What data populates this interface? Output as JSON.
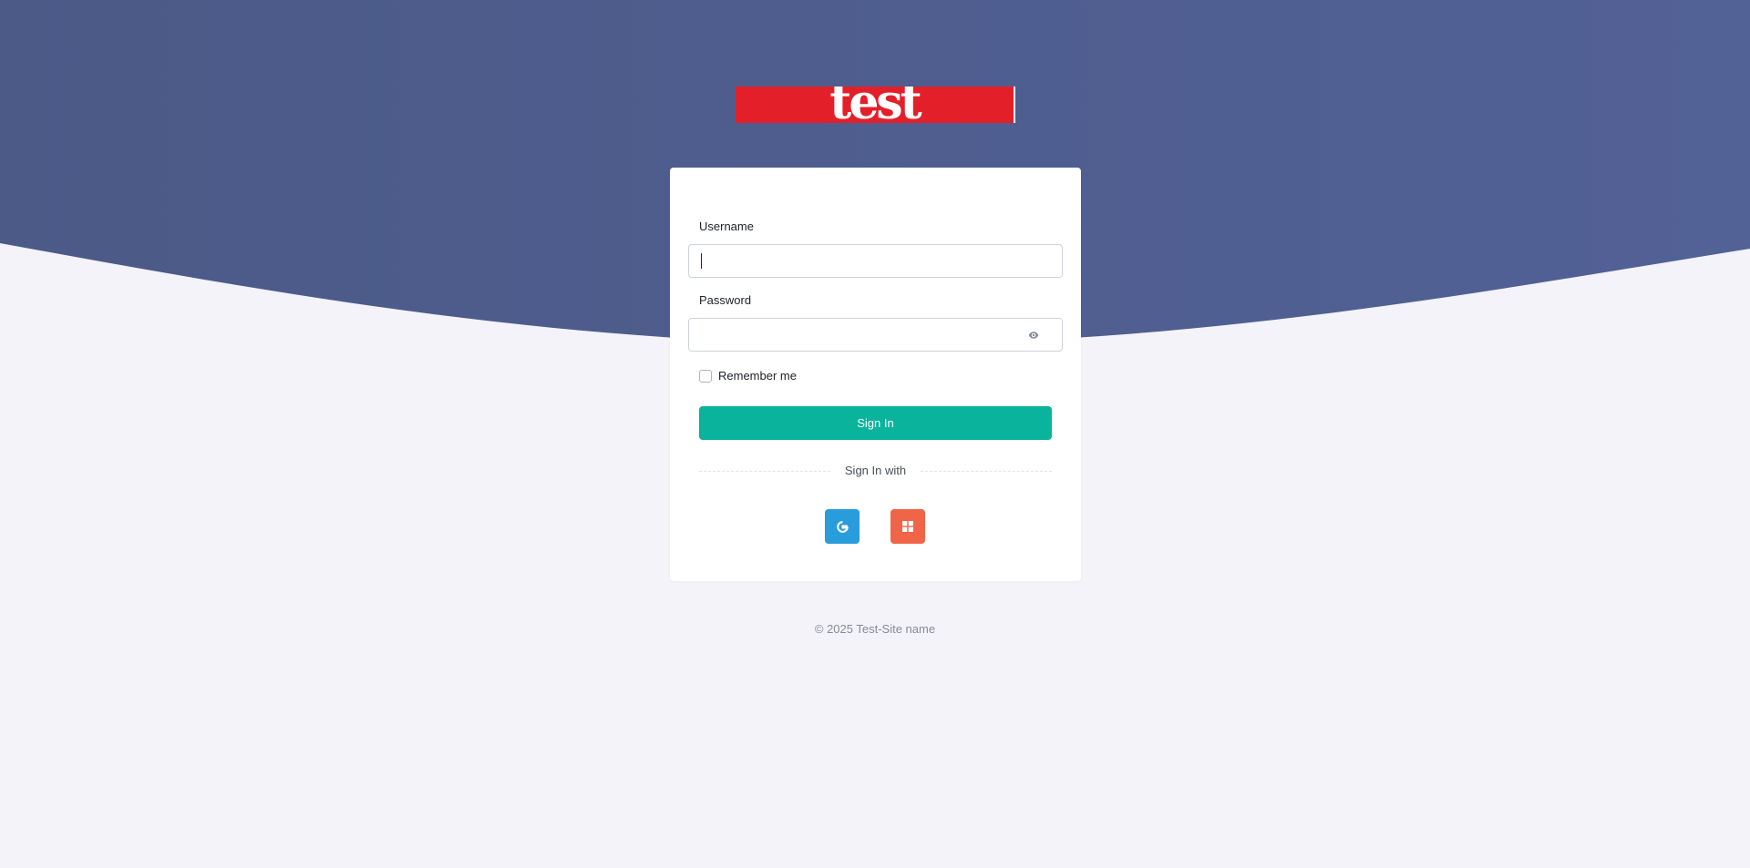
{
  "brand": {
    "logo_text": "test",
    "logo_color": "#e3202a"
  },
  "colors": {
    "header_bg": "#4c5a88",
    "page_bg": "#f3f3f9",
    "primary": "#0ab39c",
    "google": "#299cdb",
    "microsoft": "#f06548"
  },
  "form": {
    "username_label": "Username",
    "username_value": "",
    "password_label": "Password",
    "password_value": "",
    "password_toggle_icon": "eye-icon",
    "remember_label": "Remember me",
    "remember_checked": false,
    "submit_label": "Sign In"
  },
  "social": {
    "divider_text": "Sign In with",
    "providers": [
      {
        "name": "google",
        "icon": "google-icon"
      },
      {
        "name": "microsoft",
        "icon": "microsoft-icon"
      }
    ]
  },
  "footer": {
    "copyright": "© 2025 Test-Site name"
  }
}
